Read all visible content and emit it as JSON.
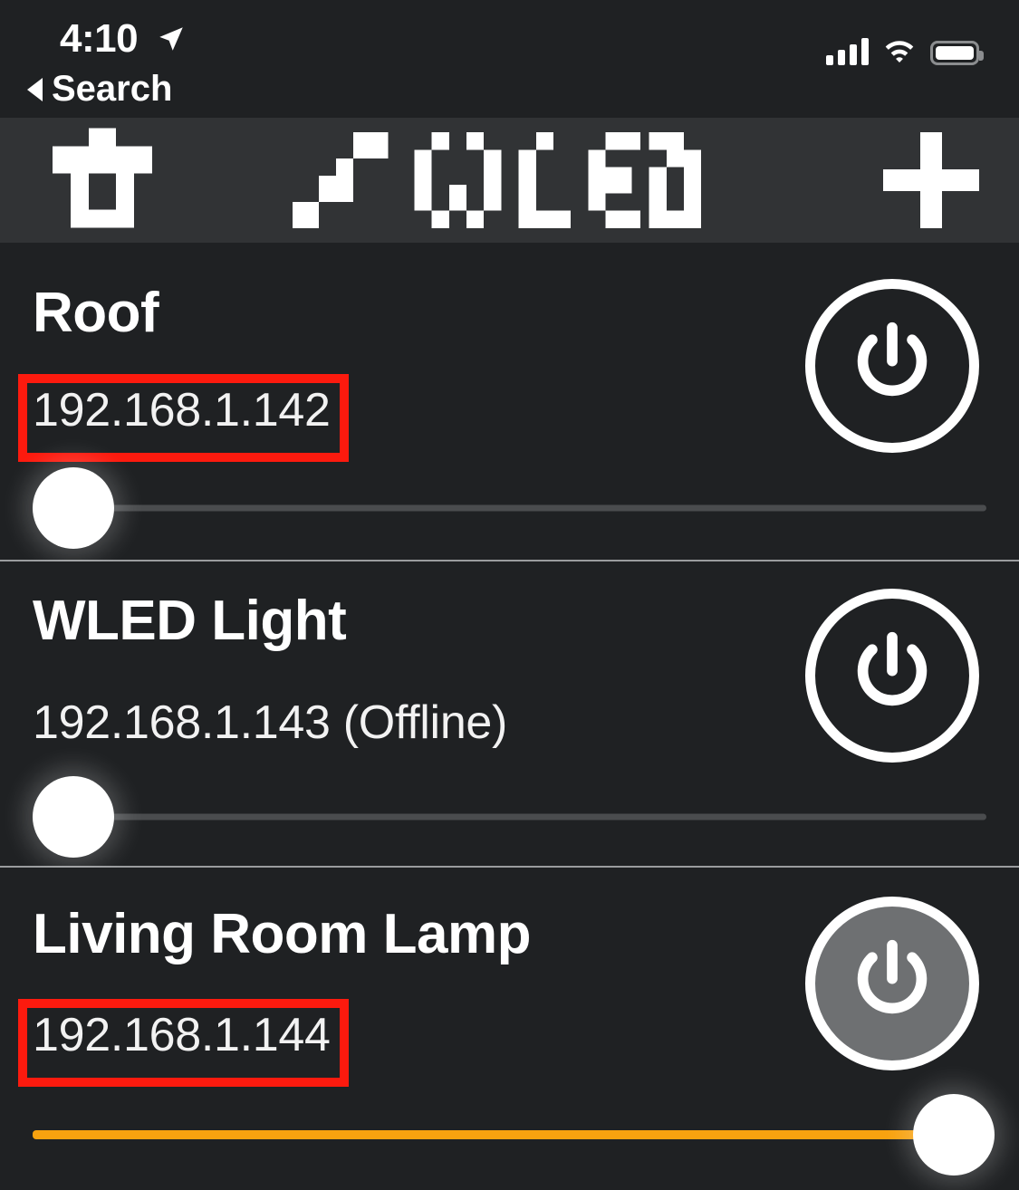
{
  "status_bar": {
    "time": "4:10",
    "location_icon": "location-arrow-icon",
    "back_label": "Search",
    "cellular_icon": "cellular-bars-icon",
    "wifi_icon": "wifi-icon",
    "battery_icon": "battery-full-icon"
  },
  "nav_bar": {
    "left_icon": "pixel-lamp-icon",
    "title": "WLED",
    "logo_icon": "wled-pixel-logo",
    "add_label": "+",
    "add_icon": "plus-icon",
    "background": "#313335"
  },
  "theme": {
    "background": "#1f2123",
    "divider": "#9a9c9e",
    "accent_on": "#f8a20f",
    "power_on_fill": "#6e7072",
    "annotation": "#fc1a0e",
    "text": "#ffffff"
  },
  "devices": [
    {
      "name": "Roof",
      "ip": "192.168.1.142",
      "status_suffix": "",
      "ip_display": "192.168.1.142",
      "power_state": "off",
      "power_icon": "power-icon",
      "brightness_percent": 0,
      "slider_filled": false,
      "annotated": true
    },
    {
      "name": "WLED Light",
      "ip": "192.168.1.143",
      "status_suffix": "(Offline)",
      "ip_display": "192.168.1.143 (Offline)",
      "power_state": "off",
      "power_icon": "power-icon",
      "brightness_percent": 0,
      "slider_filled": false,
      "annotated": false
    },
    {
      "name": "Living Room Lamp",
      "ip": "192.168.1.144",
      "status_suffix": "",
      "ip_display": "192.168.1.144",
      "power_state": "on",
      "power_icon": "power-icon",
      "brightness_percent": 100,
      "slider_filled": true,
      "annotated": true
    }
  ]
}
